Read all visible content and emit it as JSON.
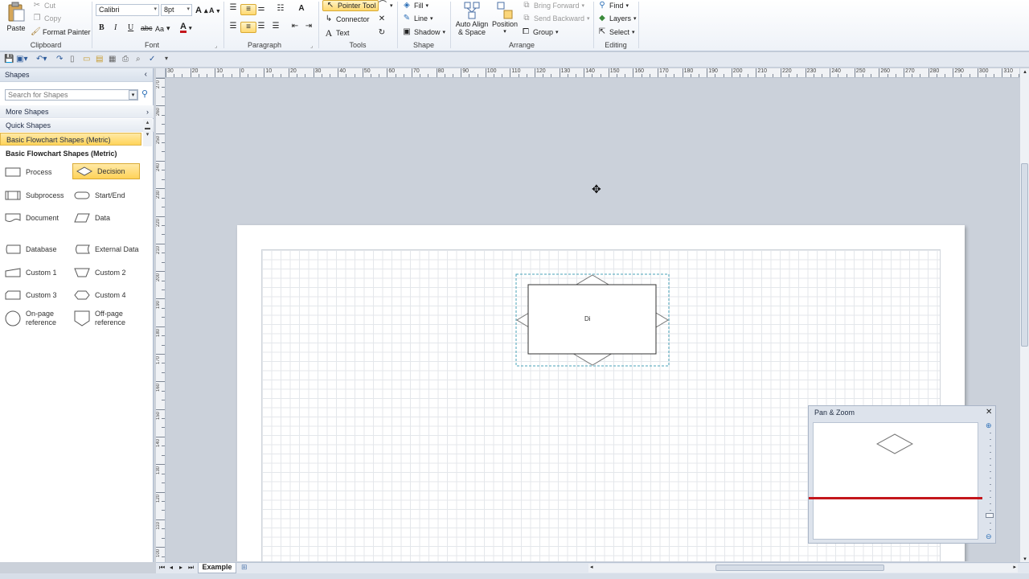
{
  "ribbon": {
    "clipboard": {
      "paste": "Paste",
      "cut": "Cut",
      "copy": "Copy",
      "format_painter": "Format Painter",
      "label": "Clipboard"
    },
    "font": {
      "family": "Calibri",
      "size": "8pt",
      "label": "Font",
      "bold": "B",
      "italic": "I",
      "underline": "U",
      "strike": "abc",
      "case": "Aa",
      "color_letter": "A",
      "grow": "A",
      "shrink": "A"
    },
    "paragraph": {
      "label": "Paragraph"
    },
    "tools": {
      "pointer": "Pointer Tool",
      "connector": "Connector",
      "text": "Text",
      "label": "Tools"
    },
    "shape": {
      "fill": "Fill",
      "line": "Line",
      "shadow": "Shadow",
      "label": "Shape"
    },
    "arrange": {
      "auto_align": "Auto Align",
      "auto_align2": "& Space",
      "position": "Position",
      "bring_forward": "Bring Forward",
      "send_backward": "Send Backward",
      "group": "Group",
      "label": "Arrange"
    },
    "editing": {
      "find": "Find",
      "layers": "Layers",
      "select": "Select",
      "label": "Editing"
    }
  },
  "shapes_panel": {
    "title": "Shapes",
    "search_placeholder": "Search for Shapes",
    "more_shapes": "More Shapes",
    "quick_shapes": "Quick Shapes",
    "active_stencil": "Basic Flowchart Shapes (Metric)",
    "stencil_title": "Basic Flowchart Shapes (Metric)",
    "items": [
      "Process",
      "Decision",
      "Subprocess",
      "Start/End",
      "Document",
      "Data",
      "Database",
      "External Data",
      "Custom 1",
      "Custom 2",
      "Custom 3",
      "Custom 4"
    ],
    "onpage": [
      "On-page",
      "reference"
    ],
    "offpage": [
      "Off-page",
      "reference"
    ]
  },
  "hruler_ticks": [
    "30",
    "20",
    "10",
    "0",
    "10",
    "20",
    "30",
    "40",
    "50",
    "60",
    "70",
    "80",
    "90",
    "100",
    "110",
    "120",
    "130",
    "140",
    "150",
    "160",
    "170",
    "180",
    "190",
    "200",
    "210",
    "220",
    "230",
    "240",
    "250",
    "260",
    "270",
    "280",
    "290",
    "300",
    "310"
  ],
  "vruler_ticks": [
    "270",
    "260",
    "250",
    "240",
    "230",
    "220",
    "210",
    "200",
    "190",
    "180",
    "170",
    "160",
    "150",
    "140",
    "130",
    "120",
    "110",
    "100"
  ],
  "canvas": {
    "shape_text": "Di"
  },
  "pan_zoom": {
    "title": "Pan & Zoom"
  },
  "tabs": {
    "page": "Example"
  },
  "colors": {
    "accent": "#ffd45a",
    "viewport": "#c4161c"
  }
}
